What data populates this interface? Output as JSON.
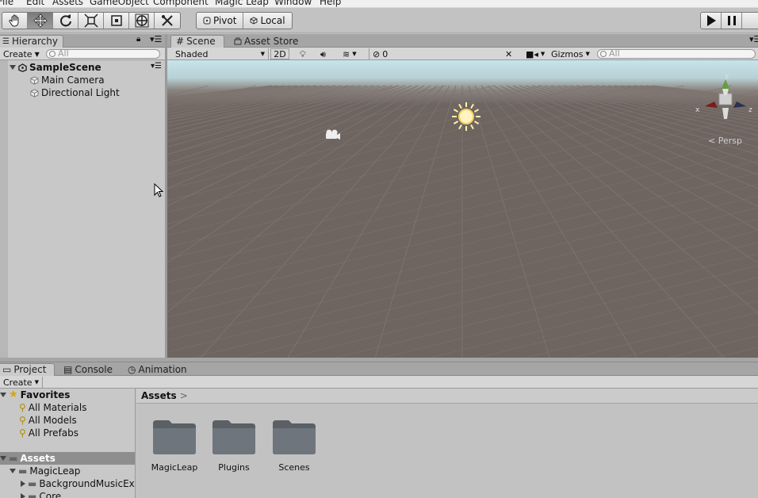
{
  "menu": [
    "File",
    "Edit",
    "Assets",
    "GameObject",
    "Component",
    "Magic Leap",
    "Window",
    "Help"
  ],
  "toolbar": {
    "tools": [
      "hand-tool",
      "move-tool",
      "rotate-tool",
      "scale-tool",
      "rect-tool",
      "transform-tool",
      "custom-tool"
    ],
    "active_tool": "move-tool",
    "pivot_label": "Pivot",
    "local_label": "Local"
  },
  "hierarchy": {
    "tab_label": "Hierarchy",
    "create_label": "Create",
    "search_placeholder": "All",
    "scene_name": "SampleScene",
    "items": [
      {
        "label": "Main Camera"
      },
      {
        "label": "Directional Light"
      }
    ]
  },
  "scene": {
    "tabs": [
      {
        "label": "Scene"
      },
      {
        "label": "Asset Store"
      }
    ],
    "shading_mode": "Shaded",
    "two_d_label": "2D",
    "hidden_count": "0",
    "gizmos_label": "Gizmos",
    "search_placeholder": "All",
    "persp_label": "< Persp",
    "axis_labels": {
      "x": "x",
      "y": "y",
      "z": "z"
    },
    "colors": {
      "sky": "#c6e4ea",
      "ground": "#6e6460",
      "grid": "#7c726d"
    }
  },
  "project": {
    "tabs": [
      {
        "label": "Project"
      },
      {
        "label": "Console"
      },
      {
        "label": "Animation"
      }
    ],
    "create_label": "Create",
    "favorites_label": "Favorites",
    "favorites": [
      {
        "label": "All Materials"
      },
      {
        "label": "All Models"
      },
      {
        "label": "All Prefabs"
      }
    ],
    "assets_root": "Assets",
    "tree": [
      {
        "label": "MagicLeap"
      },
      {
        "label": "BackgroundMusicExa"
      },
      {
        "label": "Core"
      }
    ],
    "breadcrumb": "Assets",
    "folders": [
      {
        "label": "MagicLeap"
      },
      {
        "label": "Plugins"
      },
      {
        "label": "Scenes"
      }
    ]
  }
}
